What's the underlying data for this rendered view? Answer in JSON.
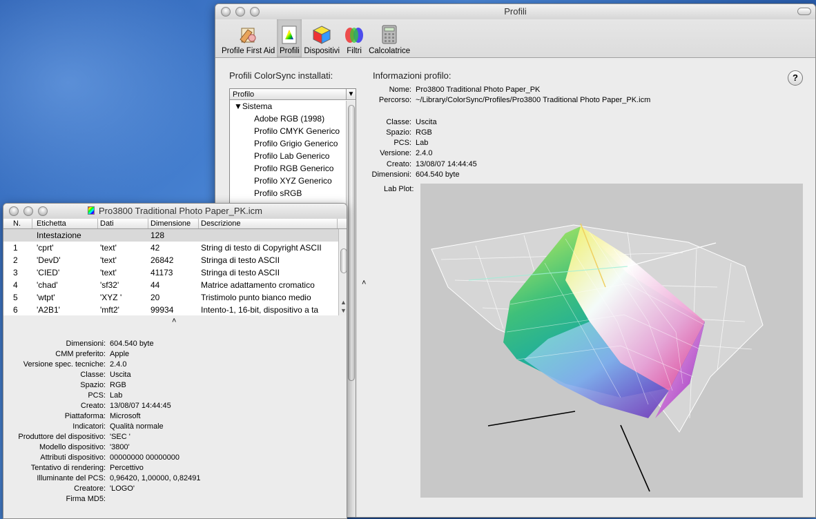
{
  "main_window": {
    "title": "Profili",
    "toolbar": [
      {
        "label": "Profile First Aid",
        "icon": "first-aid-icon"
      },
      {
        "label": "Profili",
        "icon": "profiles-icon",
        "selected": true
      },
      {
        "label": "Dispositivi",
        "icon": "devices-icon"
      },
      {
        "label": "Filtri",
        "icon": "filters-icon"
      },
      {
        "label": "Calcolatrice",
        "icon": "calculator-icon"
      }
    ],
    "installed_title": "Profili ColorSync installati:",
    "info_title": "Informazioni profilo:",
    "help_label": "?",
    "tree": {
      "column_header": "Profilo",
      "sort_glyph": "▼",
      "group": "▼Sistema",
      "items": [
        "Adobe RGB (1998)",
        "Profilo CMYK Generico",
        "Profilo Grigio Generico",
        "Profilo Lab Generico",
        "Profilo RGB Generico",
        "Profilo XYZ Generico",
        "Profilo sRGB"
      ]
    },
    "info": {
      "nome_label": "Nome:",
      "nome": "Pro3800 Traditional Photo Paper_PK",
      "percorso_label": "Percorso:",
      "percorso": "~/Library/ColorSync/Profiles/Pro3800 Traditional Photo Paper_PK.icm",
      "classe_label": "Classe:",
      "classe": "Uscita",
      "spazio_label": "Spazio:",
      "spazio": "RGB",
      "pcs_label": "PCS:",
      "pcs": "Lab",
      "versione_label": "Versione:",
      "versione": "2.4.0",
      "creato_label": "Creato:",
      "creato": "13/08/07 14:44:45",
      "dimensioni_label": "Dimensioni:",
      "dimensioni": "604.540 byte"
    },
    "lab_plot_label": "Lab Plot:",
    "lab_plot_menu": "▼"
  },
  "inspector": {
    "title": "Pro3800 Traditional Photo Paper_PK.icm",
    "columns": [
      "N.",
      "Etichetta",
      "Dati",
      "Dimensione",
      "Descrizione"
    ],
    "header_row": {
      "label": "Intestazione",
      "size": "128"
    },
    "rows": [
      {
        "n": "1",
        "tag": "'cprt'",
        "data": "'text'",
        "size": "42",
        "desc": "String di testo di Copyright ASCII"
      },
      {
        "n": "2",
        "tag": "'DevD'",
        "data": "'text'",
        "size": "26842",
        "desc": "Stringa di testo ASCII"
      },
      {
        "n": "3",
        "tag": "'CIED'",
        "data": "'text'",
        "size": "41173",
        "desc": "Stringa di testo ASCII"
      },
      {
        "n": "4",
        "tag": "'chad'",
        "data": "'sf32'",
        "size": "44",
        "desc": "Matrice adattamento cromatico"
      },
      {
        "n": "5",
        "tag": "'wtpt'",
        "data": "'XYZ '",
        "size": "20",
        "desc": "Tristimolo punto bianco medio"
      },
      {
        "n": "6",
        "tag": "'A2B1'",
        "data": "'mft2'",
        "size": "99934",
        "desc": "Intento-1, 16-bit, dispositivo a ta"
      }
    ],
    "details": [
      {
        "k": "Dimensioni:",
        "v": "604.540 byte"
      },
      {
        "k": "CMM preferito:",
        "v": "Apple"
      },
      {
        "k": "Versione spec. tecniche:",
        "v": "2.4.0"
      },
      {
        "k": "Classe:",
        "v": "Uscita"
      },
      {
        "k": "Spazio:",
        "v": "RGB"
      },
      {
        "k": "PCS:",
        "v": "Lab"
      },
      {
        "k": "Creato:",
        "v": "13/08/07 14:44:45"
      },
      {
        "k": "Piattaforma:",
        "v": "Microsoft"
      },
      {
        "k": "Indicatori:",
        "v": "Qualità normale"
      },
      {
        "k": "Produttore del dispositivo:",
        "v": "'SEC '"
      },
      {
        "k": "Modello dispositivo:",
        "v": "'3800'"
      },
      {
        "k": "Attributi dispositivo:",
        "v": "00000000 00000000"
      },
      {
        "k": "Tentativo di rendering:",
        "v": "Percettivo"
      },
      {
        "k": "Illuminante del PCS:",
        "v": "0,96420, 1,00000, 0,82491"
      },
      {
        "k": "Creatore:",
        "v": "'LOGO'"
      },
      {
        "k": "Firma MD5:",
        "v": ""
      }
    ]
  }
}
